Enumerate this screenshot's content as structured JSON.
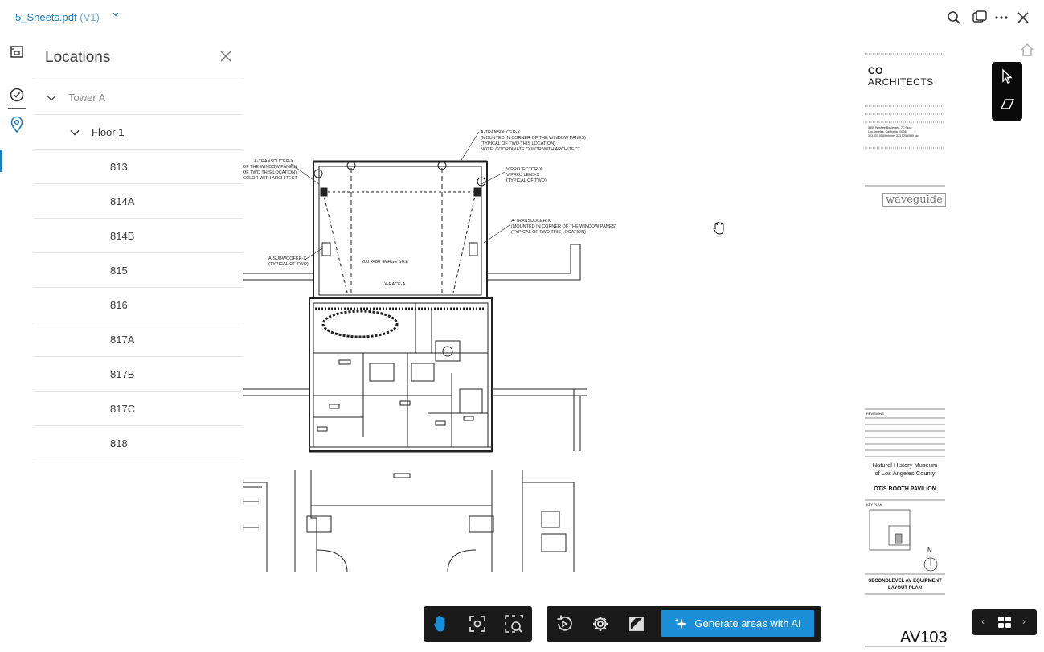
{
  "header": {
    "doc_name": "5_Sheets.pdf",
    "version": "(V1)"
  },
  "panel": {
    "title": "Locations",
    "tree": [
      {
        "label": "Tower A",
        "level": 0,
        "expanded": true
      },
      {
        "label": "Floor 1",
        "level": 1,
        "expanded": true
      },
      {
        "label": "813",
        "level": 2
      },
      {
        "label": "814A",
        "level": 2
      },
      {
        "label": "814B",
        "level": 2
      },
      {
        "label": "815",
        "level": 2
      },
      {
        "label": "816",
        "level": 2
      },
      {
        "label": "817A",
        "level": 2
      },
      {
        "label": "817B",
        "level": 2
      },
      {
        "label": "817C",
        "level": 2
      },
      {
        "label": "818",
        "level": 2
      }
    ]
  },
  "sheet": {
    "firm": "ARCHITECTS",
    "firm_mark": "CO",
    "address": "5859 Wilshire Boulevard, 7C Floor\nLos Angeles, California 90036\n323.525.0500 phone, 323.525.0955 fax",
    "consultant": "waveguide",
    "revisions": "REVISIONS",
    "client_line1": "Natural History Museum",
    "client_line2": "of Los Angeles County",
    "project": "OTIS BOOTH PAVILION",
    "key_plan": "KEY PLAN",
    "north": "N",
    "sheet_title_line1": "SECONDLEVEL AV EQUIPMENT",
    "sheet_title_line2": "LAYOUT PLAN",
    "sheet_number": "AV103",
    "annotations": {
      "transducer_top": "A-TRANSDUCER-X\n(MOUNTED IN CORNER OF THE WINDOW PANES)\n(TYPICAL OF TWO THIS LOCATION)\nNOTE: COORDINATE COLOR WITH ARCHITECT",
      "transducer_left": "A-TRANSDUCER-X\nOF THE WINDOW PANES)\nOF TWO THIS LOCATION)\nCOLOR WITH ARCHITECT",
      "projector": "V-PROJECTOR-X\nV-PROJ LENS-X\n(TYPICAL OF TWO)",
      "transducer_right": "A-TRANSDUCER-X\n(MOUNTED IN CORNER OF THE WINDOW PANES)\n(TYPICAL OF TWO THIS LOCATION)",
      "subwoofer": "A-SUBWOOFER-X\n(TYPICAL OF TWO)",
      "image_size": "200\"x480\" IMAGE SIZE",
      "rack": "X-RACK-A"
    }
  },
  "toolbar": {
    "generate_label": "Generate areas with AI"
  },
  "colors": {
    "accent": "#1d7cc0",
    "button_blue": "#1a8ed6",
    "toolbar_bg": "#1a1a1a"
  }
}
